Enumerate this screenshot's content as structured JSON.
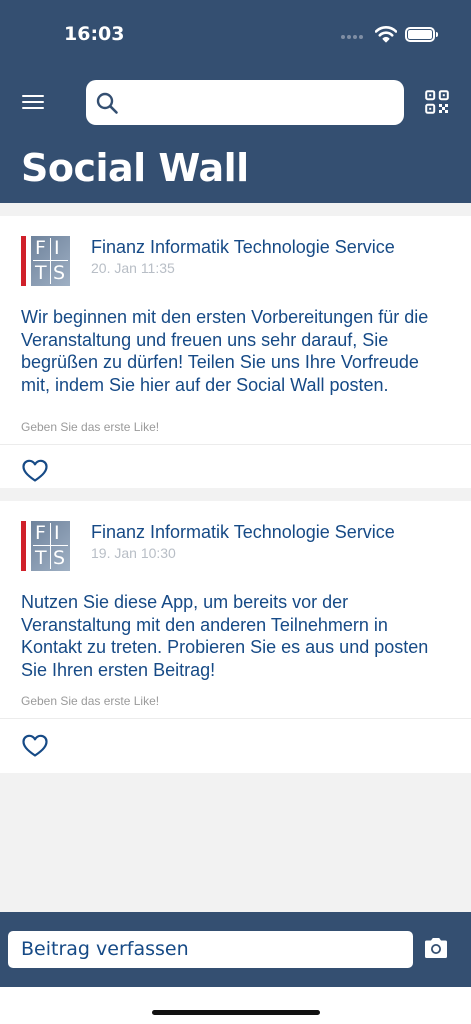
{
  "status_bar": {
    "time": "16:03"
  },
  "header": {
    "search": {
      "placeholder": ""
    },
    "title": "Social Wall"
  },
  "icons": {
    "menu": "hamburger-menu-icon",
    "search": "search-icon",
    "qr": "qr-code-icon",
    "like": "heart-outline-icon",
    "camera": "camera-icon"
  },
  "colors": {
    "brand_navy": "#344f71",
    "text_blue": "#164a86",
    "logo_red": "#d0202a"
  },
  "posts": [
    {
      "logo_letters": [
        "F",
        "I",
        "T",
        "S"
      ],
      "author": "Finanz Informatik Technologie Service",
      "time": "20. Jan 11:35",
      "text": "Wir beginnen mit den ersten Vorbereitungen für die Veranstaltung und freuen uns sehr darauf, Sie begrüßen zu dürfen! Teilen Sie uns Ihre Vorfreude mit, indem Sie hier auf der Social Wall posten.",
      "likes_text": "Geben Sie das erste Like!"
    },
    {
      "logo_letters": [
        "F",
        "I",
        "T",
        "S"
      ],
      "author": "Finanz Informatik Technologie Service",
      "time": "19. Jan 10:30",
      "text": "Nutzen Sie diese App, um bereits vor der Veranstaltung mit den anderen Teilnehmern in Kontakt zu treten. Probieren Sie es aus und posten Sie Ihren ersten Beitrag!",
      "likes_text": "Geben Sie das erste Like!"
    }
  ],
  "composer": {
    "placeholder": "Beitrag verfassen"
  }
}
